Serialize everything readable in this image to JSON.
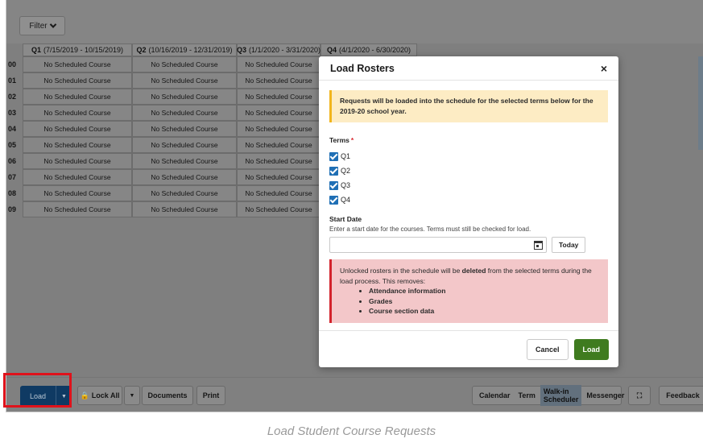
{
  "toolbar": {
    "filter_label": "Filter"
  },
  "schedule": {
    "columns": [
      {
        "term": "Q1",
        "range": "(7/15/2019 - 10/15/2019)"
      },
      {
        "term": "Q2",
        "range": "(10/16/2019 - 12/31/2019)"
      },
      {
        "term": "Q3",
        "range": "(1/1/2020 - 3/31/2020)"
      },
      {
        "term": "Q4",
        "range": "(4/1/2020 - 6/30/2020)"
      }
    ],
    "rows": [
      {
        "label": "00",
        "cells": [
          "No Scheduled Course",
          "No Scheduled Course",
          "No Scheduled Course"
        ]
      },
      {
        "label": "01",
        "cells": [
          "No Scheduled Course",
          "No Scheduled Course",
          "No Scheduled Course"
        ]
      },
      {
        "label": "02",
        "cells": [
          "No Scheduled Course",
          "No Scheduled Course",
          "No Scheduled Course"
        ]
      },
      {
        "label": "03",
        "cells": [
          "No Scheduled Course",
          "No Scheduled Course",
          "No Scheduled Course"
        ]
      },
      {
        "label": "04",
        "cells": [
          "No Scheduled Course",
          "No Scheduled Course",
          "No Scheduled Course"
        ]
      },
      {
        "label": "05",
        "cells": [
          "No Scheduled Course",
          "No Scheduled Course",
          "No Scheduled Course"
        ]
      },
      {
        "label": "06",
        "cells": [
          "No Scheduled Course",
          "No Scheduled Course",
          "No Scheduled Course"
        ]
      },
      {
        "label": "07",
        "cells": [
          "No Scheduled Course",
          "No Scheduled Course",
          "No Scheduled Course"
        ]
      },
      {
        "label": "08",
        "cells": [
          "No Scheduled Course",
          "No Scheduled Course",
          "No Scheduled Course"
        ]
      },
      {
        "label": "09",
        "cells": [
          "No Scheduled Course",
          "No Scheduled Course",
          "No Scheduled Course"
        ]
      }
    ]
  },
  "bottom_bar": {
    "load_label": "Load",
    "lock_all_label": "Lock All",
    "documents_label": "Documents",
    "print_label": "Print",
    "tabs": [
      "Calendar",
      "Term",
      "Walk-in Scheduler",
      "Messenger"
    ],
    "active_tab": "Walk-in Scheduler",
    "feedback_label": "Feedback"
  },
  "modal": {
    "title": "Load Rosters",
    "close_symbol": "×",
    "info_text": "Requests will be loaded into the schedule for the selected terms below for the 2019-20 school year.",
    "terms_label": "Terms",
    "required_mark": "*",
    "terms": [
      "Q1",
      "Q2",
      "Q3",
      "Q4"
    ],
    "start_date_label": "Start Date",
    "start_date_help": "Enter a start date for the courses. Terms must still be checked for load.",
    "start_date_value": "",
    "today_label": "Today",
    "warning_pre": "Unlocked rosters in the schedule will be ",
    "warning_bold": "deleted",
    "warning_post": " from the selected terms during the load process. This removes:",
    "warning_items": [
      "Attendance information",
      "Grades",
      "Course section data"
    ],
    "cancel_label": "Cancel",
    "load_label": "Load"
  },
  "caption": "Load Student Course Requests",
  "colors": {
    "primary": "#3f7b1f",
    "load_button": "#0f3a63",
    "highlight": "#e0121b",
    "checkbox": "#1f6fb5"
  }
}
